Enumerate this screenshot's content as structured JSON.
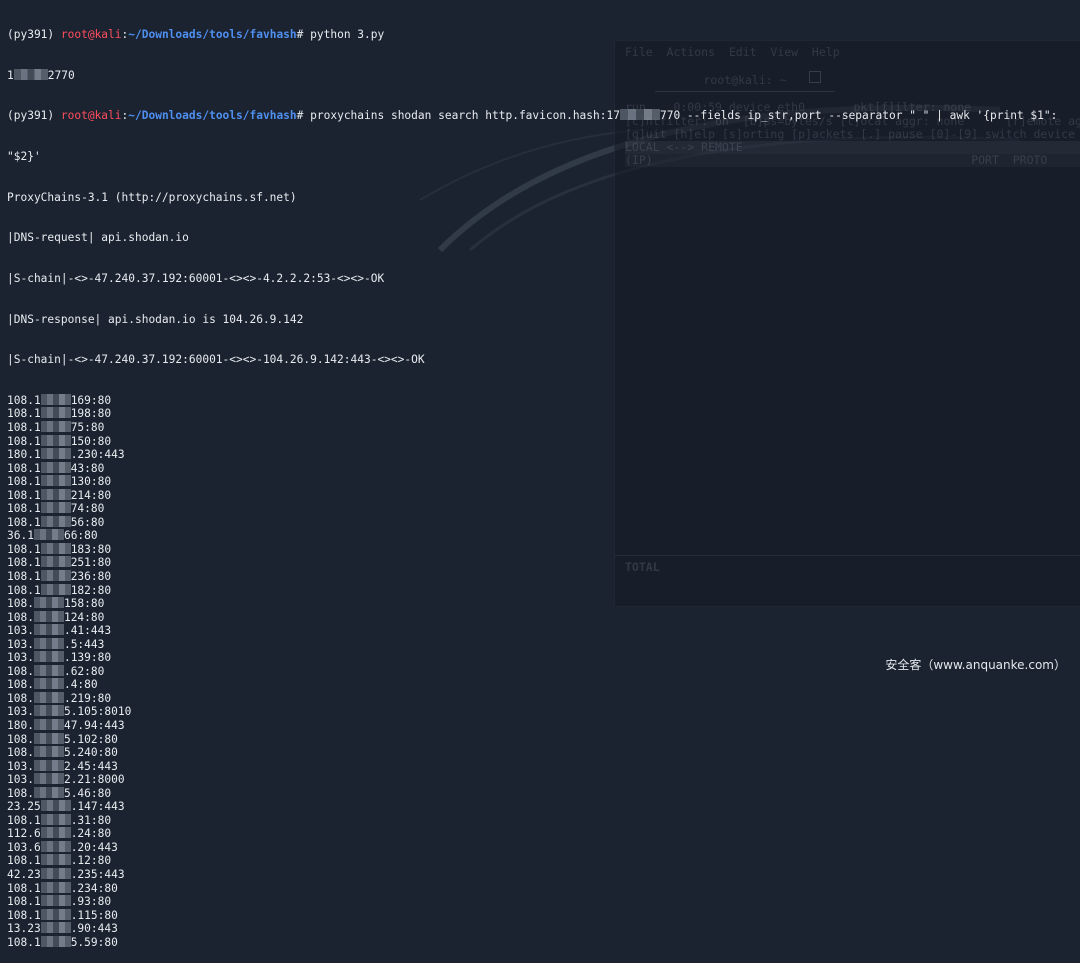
{
  "colors": {
    "background": "#1b2330",
    "text": "#e8ecf0",
    "prompt_user": "#ff4d5d",
    "prompt_path": "#4f8ff0"
  },
  "prompt": {
    "env": "(py391) ",
    "user_host": "root@kali",
    "sep": ":",
    "path": "~/Downloads/tools/favhash",
    "hash": "# "
  },
  "commands": {
    "cmd1": "python 3.py",
    "cmd1_output_suffix": "2770",
    "cmd2_part1": "proxychains shodan search http.favicon.hash:17",
    "cmd2_part2": "770 --fields ip_str,port --separator \" \" | awk '{print $1\":",
    "cmd2_wrap": "\"$2}'"
  },
  "proxychains": {
    "banner": "ProxyChains-3.1 (http://proxychains.sf.net)",
    "dns_request": "|DNS-request| api.shodan.io",
    "chain1": "|S-chain|-<>-47.240.37.192:60001-<><>-4.2.2.2:53-<><>-OK",
    "dns_response": "|DNS-response| api.shodan.io is 104.26.9.142",
    "chain2": "|S-chain|-<>-47.240.37.192:60001-<><>-104.26.9.142:443-<><>-OK"
  },
  "results": [
    {
      "pre": "108.1",
      "post": "169:80"
    },
    {
      "pre": "108.1",
      "post": "198:80"
    },
    {
      "pre": "108.1",
      "post": "75:80"
    },
    {
      "pre": "108.1",
      "post": "150:80"
    },
    {
      "pre": "180.1",
      "post": ".230:443"
    },
    {
      "pre": "108.1",
      "post": "43:80"
    },
    {
      "pre": "108.1",
      "post": "130:80"
    },
    {
      "pre": "108.1",
      "post": "214:80"
    },
    {
      "pre": "108.1",
      "post": "74:80"
    },
    {
      "pre": "108.1",
      "post": "56:80"
    },
    {
      "pre": "36.1",
      "post": "66:80"
    },
    {
      "pre": "108.1",
      "post": "183:80"
    },
    {
      "pre": "108.1",
      "post": "251:80"
    },
    {
      "pre": "108.1",
      "post": "236:80"
    },
    {
      "pre": "108.1",
      "post": "182:80"
    },
    {
      "pre": "108.",
      "post": "158:80"
    },
    {
      "pre": "108.",
      "post": "124:80"
    },
    {
      "pre": "103.",
      "post": ".41:443"
    },
    {
      "pre": "103.",
      "post": ".5:443"
    },
    {
      "pre": "103.",
      "post": ".139:80"
    },
    {
      "pre": "108.",
      "post": ".62:80"
    },
    {
      "pre": "108.",
      "post": ".4:80"
    },
    {
      "pre": "108.",
      "post": ".219:80"
    },
    {
      "pre": "103.",
      "post": "5.105:8010"
    },
    {
      "pre": "180.",
      "post": "47.94:443"
    },
    {
      "pre": "108.",
      "post": "5.102:80"
    },
    {
      "pre": "108.",
      "post": "5.240:80"
    },
    {
      "pre": "103.",
      "post": "2.45:443"
    },
    {
      "pre": "103.",
      "post": "2.21:8000"
    },
    {
      "pre": "108.",
      "post": "5.46:80"
    },
    {
      "pre": "23.25",
      "post": ".147:443"
    },
    {
      "pre": "108.1",
      "post": ".31:80"
    },
    {
      "pre": "112.6",
      "post": ".24:80"
    },
    {
      "pre": "103.6",
      "post": ".20:443"
    },
    {
      "pre": "108.1",
      "post": ".12:80"
    },
    {
      "pre": "42.23",
      "post": ".235:443"
    },
    {
      "pre": "108.1",
      "post": ".234:80"
    },
    {
      "pre": "108.1",
      "post": ".93:80"
    },
    {
      "pre": "108.1",
      "post": ".115:80"
    },
    {
      "pre": "13.23",
      "post": ".90:443"
    },
    {
      "pre": "108.1",
      "post": "5.59:80"
    }
  ],
  "background_window": {
    "menu": "File  Actions  Edit  View  Help",
    "tab_title": "root@kali: ~",
    "line1": "run    0:00:59 device eth0       pkt[f]ilter: none",
    "line2": "[c]ntfilter: on  [b]ps=bytes/s [l]ocal aggr: none      [r]emote aggr",
    "line3": "[q]uit [h]elp [s]orting [p]ackets [.] pause [0]-[9] switch device",
    "bar1": "LOCAL <--> REMOTE",
    "bar2": "(IP)                                              PORT  PROTO",
    "total": "TOTAL"
  },
  "watermark": "安全客（www.anquanke.com）"
}
